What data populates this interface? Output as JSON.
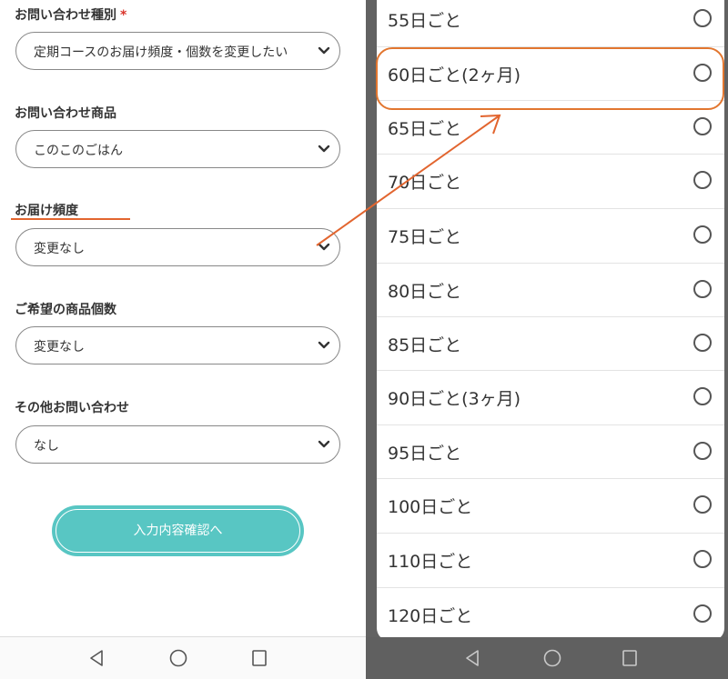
{
  "form": {
    "fields": [
      {
        "label": "お問い合わせ種別",
        "required_mark": "*",
        "value": "定期コースのお届け頻度・個数を変更したい"
      },
      {
        "label": "お問い合わせ商品",
        "value": "このこのごはん"
      },
      {
        "label": "お届け頻度",
        "value": "変更なし"
      },
      {
        "label": "ご希望の商品個数",
        "value": "変更なし"
      },
      {
        "label": "その他お問い合わせ",
        "value": "なし"
      }
    ],
    "submit_label": "入力内容確認へ"
  },
  "dropdown": {
    "options": [
      "55日ごと",
      "60日ごと(2ヶ月)",
      "65日ごと",
      "70日ごと",
      "75日ごと",
      "80日ごと",
      "85日ごと",
      "90日ごと(3ヶ月)",
      "95日ごと",
      "100日ごと",
      "110日ごと",
      "120日ごと"
    ],
    "highlighted_option": "60日ごと(2ヶ月)"
  },
  "colors": {
    "accent_orange": "#e2652f",
    "button_teal": "#58c6c3",
    "required_red": "#d9342b"
  },
  "icons": {
    "nav": [
      "back-triangle-icon",
      "home-circle-icon",
      "recents-square-icon"
    ],
    "select": "chevron-down-icon",
    "option": "radio-empty-icon"
  }
}
